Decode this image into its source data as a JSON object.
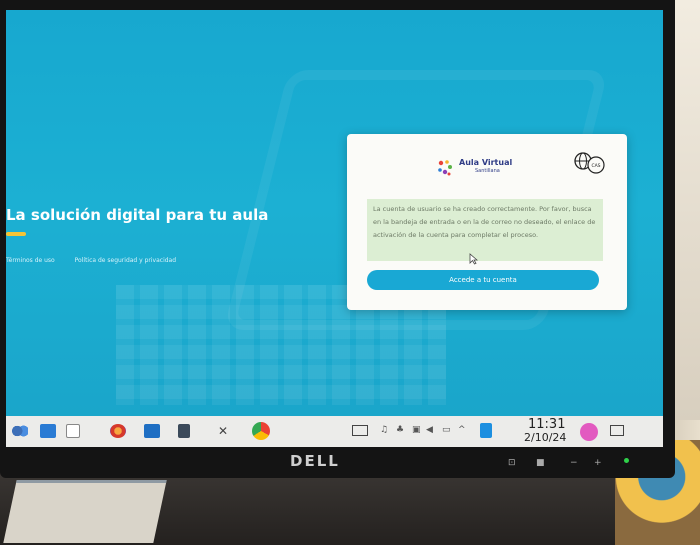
{
  "page": {
    "headline": "La solución digital para tu aula",
    "links": [
      "Términos de uso",
      "Política de seguridad y privacidad"
    ]
  },
  "dialog": {
    "brand_title": "Aula Virtual",
    "brand_subtitle": "Santillana",
    "badge_text": "CAS",
    "message": "La cuenta de usuario se ha creado correctamente. Por favor, busca en la bandeja de entrada o en la de correo no deseado, el enlace de activación de la cuenta para completar el proceso.",
    "cta_label": "Accede a tu cuenta"
  },
  "taskbar": {
    "time": "11:31",
    "date": "2/10/24"
  },
  "monitor": {
    "brand": "DELL"
  },
  "colors": {
    "accent": "#19a8d4",
    "highlight": "#f5c435",
    "message_bg": "#dceed3"
  }
}
